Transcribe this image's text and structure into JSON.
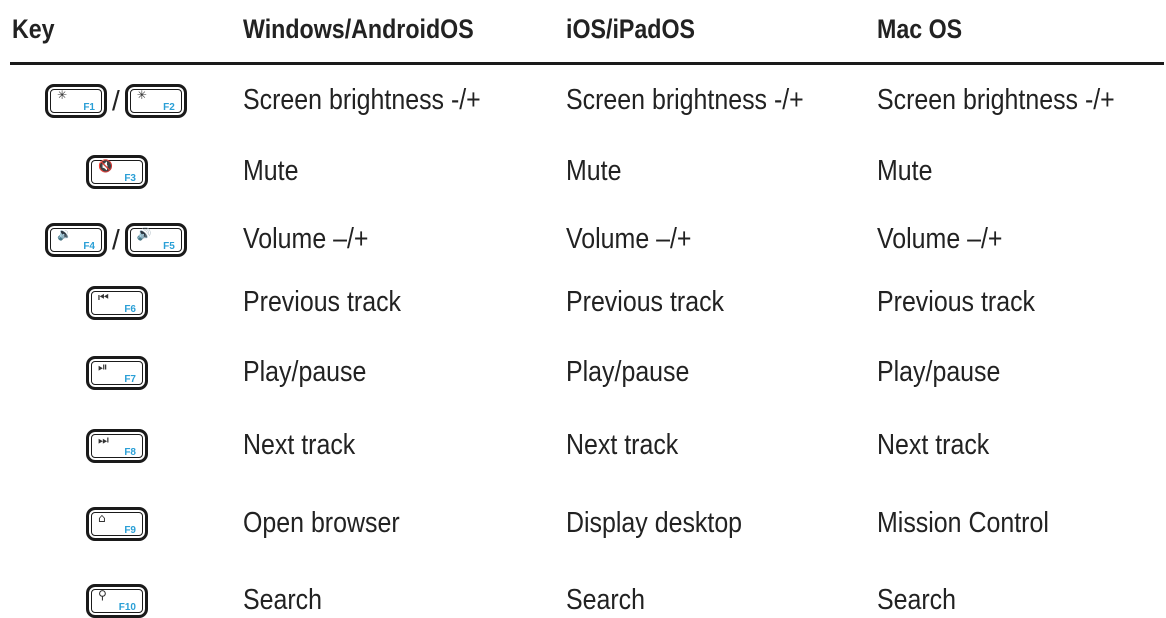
{
  "headers": {
    "key": "Key",
    "windows": "Windows/AndroidOS",
    "ios": "iOS/iPadOS",
    "mac": "Mac OS"
  },
  "rows": [
    {
      "keys": [
        {
          "fn": "F1",
          "symbol": "✳",
          "icon": "brightness-down-icon"
        },
        {
          "fn": "F2",
          "symbol": "✳",
          "icon": "brightness-up-icon"
        }
      ],
      "windows": "Screen brightness -/+",
      "ios": "Screen brightness -/+",
      "mac": "Screen brightness -/+"
    },
    {
      "keys": [
        {
          "fn": "F3",
          "symbol": "🔇",
          "icon": "mute-icon"
        }
      ],
      "windows": "Mute",
      "ios": "Mute",
      "mac": "Mute"
    },
    {
      "keys": [
        {
          "fn": "F4",
          "symbol": "🔉",
          "icon": "volume-down-icon"
        },
        {
          "fn": "F5",
          "symbol": "🔊",
          "icon": "volume-up-icon"
        }
      ],
      "windows": "Volume –/+",
      "ios": "Volume –/+",
      "mac": "Volume –/+"
    },
    {
      "keys": [
        {
          "fn": "F6",
          "symbol": "⏮",
          "icon": "previous-track-icon"
        }
      ],
      "windows": "Previous track",
      "ios": "Previous track",
      "mac": "Previous track"
    },
    {
      "keys": [
        {
          "fn": "F7",
          "symbol": "⏯",
          "icon": "play-pause-icon"
        }
      ],
      "windows": "Play/pause",
      "ios": "Play/pause",
      "mac": "Play/pause"
    },
    {
      "keys": [
        {
          "fn": "F8",
          "symbol": "⏭",
          "icon": "next-track-icon"
        }
      ],
      "windows": "Next track",
      "ios": "Next track",
      "mac": "Next track"
    },
    {
      "keys": [
        {
          "fn": "F9",
          "symbol": "⌂",
          "icon": "home-icon"
        }
      ],
      "windows": "Open browser",
      "ios": "Display desktop",
      "mac": "Mission Control"
    },
    {
      "keys": [
        {
          "fn": "F10",
          "symbol": "⚲",
          "icon": "search-icon"
        }
      ],
      "windows": "Search",
      "ios": "Search",
      "mac": "Search"
    }
  ]
}
